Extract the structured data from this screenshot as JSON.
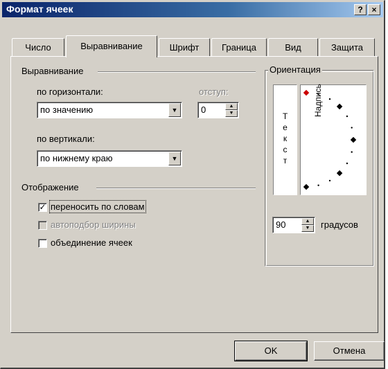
{
  "window": {
    "title": "Формат ячеек",
    "help_label": "?",
    "close_label": "×"
  },
  "tabs": [
    {
      "label": "Число"
    },
    {
      "label": "Выравнивание",
      "active": true
    },
    {
      "label": "Шрифт"
    },
    {
      "label": "Граница"
    },
    {
      "label": "Вид"
    },
    {
      "label": "Защита"
    }
  ],
  "alignment": {
    "group_label": "Выравнивание",
    "horizontal_label": "по горизонтали:",
    "horizontal_value": "по значению",
    "indent_label": "отступ:",
    "indent_value": "0",
    "vertical_label": "по вертикали:",
    "vertical_value": "по нижнему краю"
  },
  "display": {
    "group_label": "Отображение",
    "wrap_label": "переносить по словам",
    "wrap_checked": true,
    "autofit_label": "автоподбор ширины",
    "autofit_checked": false,
    "autofit_disabled": true,
    "merge_label": "объединение ячеек",
    "merge_checked": false
  },
  "orientation": {
    "group_label": "Ориентация",
    "vertical_text_letters": [
      "Т",
      "е",
      "к",
      "с",
      "т"
    ],
    "dial_label": "Надпись",
    "degrees_value": "90",
    "degrees_label": "градусов",
    "marker_color": "#cc0000"
  },
  "buttons": {
    "ok_label": "OK",
    "cancel_label": "Отмена"
  }
}
